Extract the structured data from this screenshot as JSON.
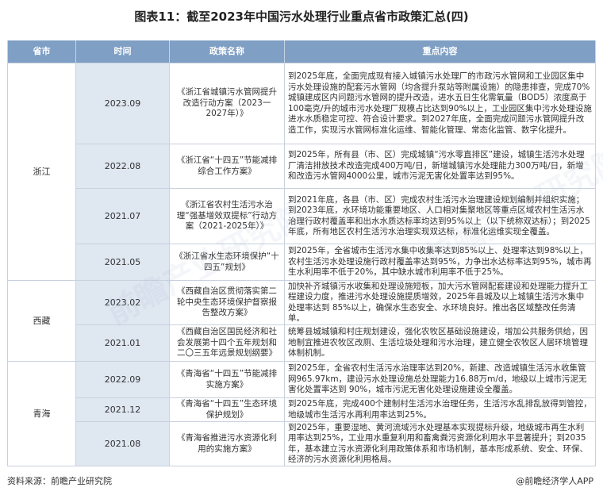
{
  "title": "图表11：截至2023年中国污水处理行业重点省市政策汇总(四)",
  "headers": [
    "省市",
    "时间",
    "政策名称",
    "重点内容"
  ],
  "rows": [
    {
      "province": "浙江",
      "date": "2023.09",
      "name": "《浙江省城镇污水管网提升改造行动方案（2023一2027年）》",
      "content": "到2025年底，全面完成现有接入城镇污水处理厂的市政污水管网和工业园区集中污水处理设施的配套污水管网（均含提升泵站等附属设施）的隐患排查，完成70%城镇建成区内问题污水管网的提升改造，进水五日生化需氧量（BOD5）浓度高于100毫克/升的城市污水处理厂规模占比达到90%以上，工业园区集中污水处理设施进水水质稳定可控、符合设计要求。到2027年底，全面完成问题污水管网提升改造工作，实现污水管网标准化运维、智能化管理、常态化监管、数字化提升。"
    },
    {
      "province": "",
      "date": "2022.08",
      "name": "《浙江省“十四五”节能减排综合工作方案》",
      "content": "到2025年，所有县（市、区）完成城镇“污水零直排区”建设，城镇生活污水处理厂清洁排放技术改造完成400万吨/日，新增城镇污水处理能力300万吨/日，新增和改造污水管网4000公里，城市污泥无害化处置率达到95%。"
    },
    {
      "province": "",
      "date": "2021.07",
      "name": "《浙江省农村生活污水治理“强基增效双提标”行动方案（2021-2025年）》",
      "content": "到2021年底，各县（市、区）完成农村生活污水治理建设规划编制并组织实施；到2023年底，水环境功能重要地区、人口相对集聚地区等重点区域农村生活污水治理行政村覆盖率和出水水质达标率均达到95%以上（以下统称双达标）；到2025年底，所有地区农村生活污水治理实现双达标，标准化运维实现全覆盖。"
    },
    {
      "province": "",
      "date": "2021.05",
      "name": "《浙江省水生态环境保护“十四五”规划》",
      "content": "到2025年，全省城市生活污水集中收集率达到85%以上、处理率达到98%以上，农村生活污水处理设施行政村覆盖率达到95%，力争出水达标率达到95%，城市再生水利用率不低于20%，其中缺水城市利用率不低于25%。"
    },
    {
      "province": "西藏",
      "date": "2023.02",
      "name": "《西藏自治区贯彻落实第二轮中央生态环境保护督察报告整改方案》",
      "content": "加快补齐城镇污水收集和处理设施短板，加大污水管网配套建设和处理能力提升工程建设力度，推进污水处理设施提质增效，2025年县城及以上城镇生活污水集中处理率达到 85%以上，确保水生态安全、水环境良好。推出各区域整改任务清单。"
    },
    {
      "province": "",
      "date": "2021.01",
      "name": "《西藏自治区国民经济和社会发展第十四个五年规划和二〇三五年远景规划纲要》",
      "content": "统筹县城城镇和村庄规划建设，强化农牧区基础设施建设，增加公共服务供给，因地制宜推进农牧区改厕、生活垃圾处理和污水治理，建立健全农牧区人居环境管理体制机制。"
    },
    {
      "province": "青海",
      "date": "2022.09",
      "name": "《青海省“十四五”节能减排实施方案》",
      "content": "到2025年，全省农村生活污水治理率达到20%，新建、改造城镇生活污水收集管网965.97km，建设污水处理设施总处理能力16.88万m/d，地级以上城市污泥无害化处置率达到 90%，城市污泥无害化处理设施建设全覆盖。"
    },
    {
      "province": "",
      "date": "2021.12",
      "name": "《青海省“十四五”生态环境保护规划》",
      "content": "到2025年底，完成400个建制村生活污水治理任务，生活污水乱排乱放得到管控，地级城市生活污水再利用率达到25%。"
    },
    {
      "province": "",
      "date": "2021.08",
      "name": "《青海省推进污水资源化利用的实施方案》",
      "content": "到2025年，重要湿地、黄河流域污水处理基本实现提标升级，地级城市再生水利用率达到25%，工业用水重复利用和畜禽粪污资源化利用水平显著提升；到2035年，基本建立污水资源化利用政策体系和市场机制，基本形成系统、安全、环保、经济的污水资源化利用格局。"
    }
  ],
  "footer": {
    "source": "资料来源：前瞻产业研究院",
    "brand": "@前瞻经济学人APP"
  },
  "watermark": "前瞻产业研究院",
  "colors": {
    "header_bg": "#7f9fc4",
    "date_bg": "#dfe7f1",
    "border": "#c8d2de"
  }
}
